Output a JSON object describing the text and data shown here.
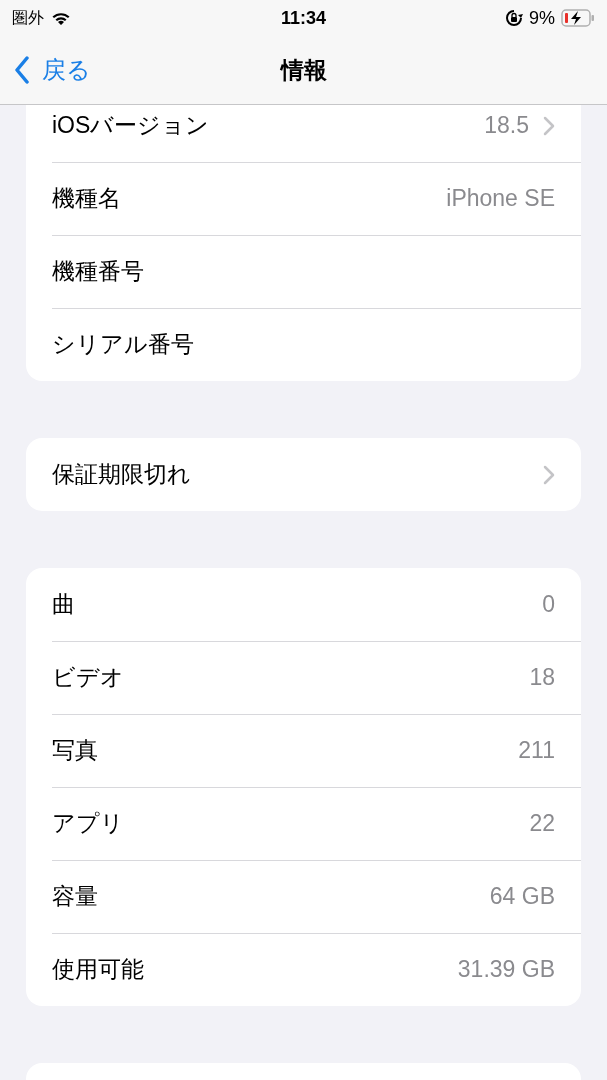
{
  "status_bar": {
    "carrier": "圏外",
    "time": "11:34",
    "battery_percent": "9%"
  },
  "nav_bar": {
    "back": "戻る",
    "title": "情報"
  },
  "groups": [
    {
      "rows": [
        {
          "label": "iOSバージョン",
          "value": "18.5",
          "kind": "link"
        },
        {
          "label": "機種名",
          "value": "iPhone SE",
          "kind": "plain"
        },
        {
          "label": "機種番号",
          "kind": "plain"
        },
        {
          "label": "シリアル番号",
          "kind": "plain"
        }
      ]
    },
    {
      "rows": [
        {
          "label": "保証期限切れ",
          "kind": "link"
        }
      ]
    },
    {
      "rows": [
        {
          "label": "曲",
          "value": "0",
          "kind": "plain"
        },
        {
          "label": "ビデオ",
          "value": "18",
          "kind": "plain"
        },
        {
          "label": "写真",
          "value": "211",
          "kind": "plain"
        },
        {
          "label": "アプリ",
          "value": "22",
          "kind": "plain"
        },
        {
          "label": "容量",
          "value": "64 GB",
          "kind": "plain"
        },
        {
          "label": "使用可能",
          "value": "31.39 GB",
          "kind": "plain"
        }
      ]
    }
  ]
}
